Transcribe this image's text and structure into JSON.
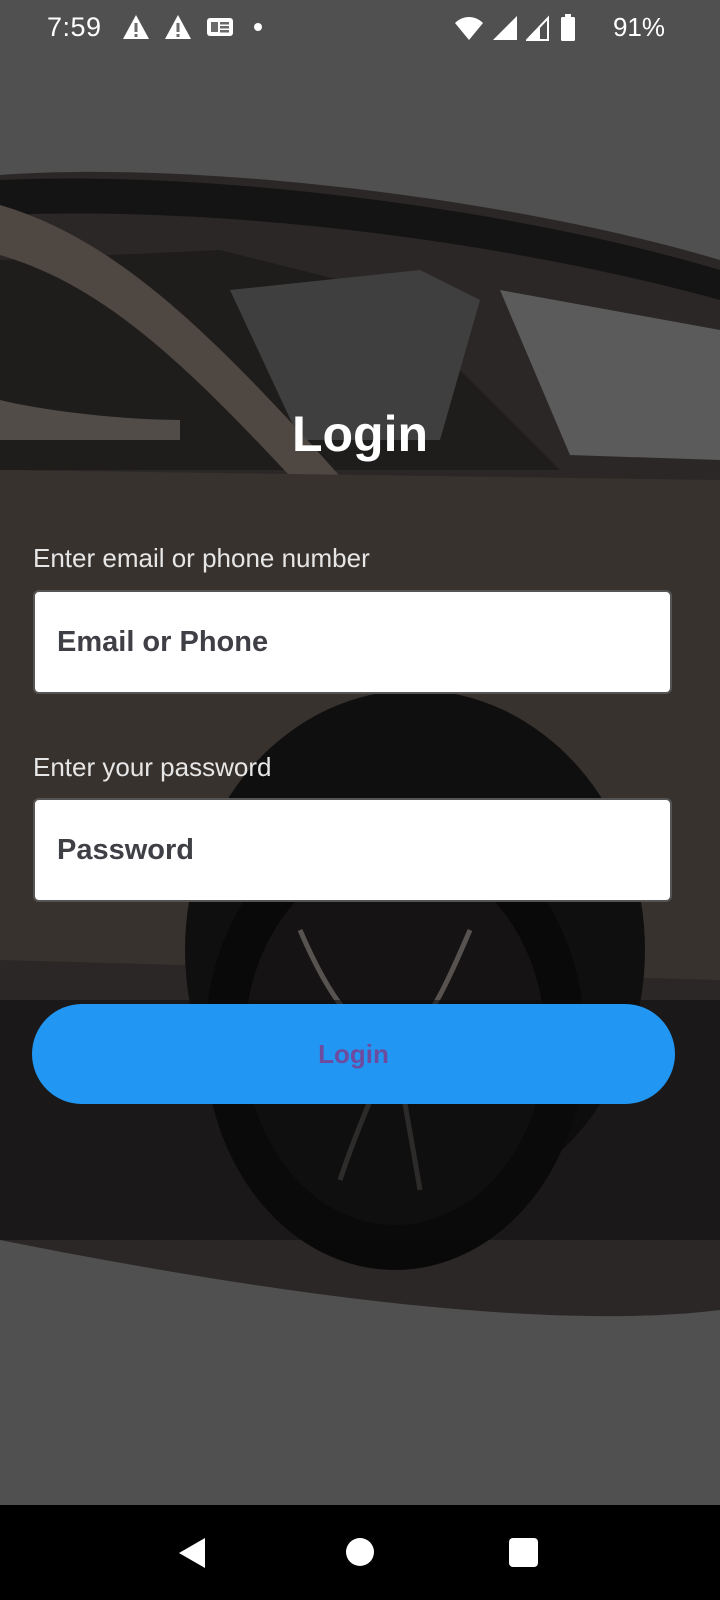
{
  "status_bar": {
    "time": "7:59",
    "battery_percent": "91%",
    "left_icons": [
      "warning-icon",
      "warning-icon",
      "news-icon",
      "notification-dot-icon"
    ],
    "right_icons": [
      "wifi-icon",
      "signal-icon",
      "signal-icon",
      "battery-icon"
    ]
  },
  "login": {
    "title": "Login",
    "email_label": "Enter email or phone number",
    "email_placeholder": "Email or Phone",
    "email_value": "",
    "password_label": "Enter your password",
    "password_placeholder": "Password",
    "password_value": "",
    "button_label": "Login"
  },
  "nav_bar": {
    "icons": [
      "back-icon",
      "home-icon",
      "recents-icon"
    ]
  },
  "colors": {
    "accent": "#2196f3",
    "button_text": "#6d4c9f",
    "overlay": "#6b6b6b"
  }
}
